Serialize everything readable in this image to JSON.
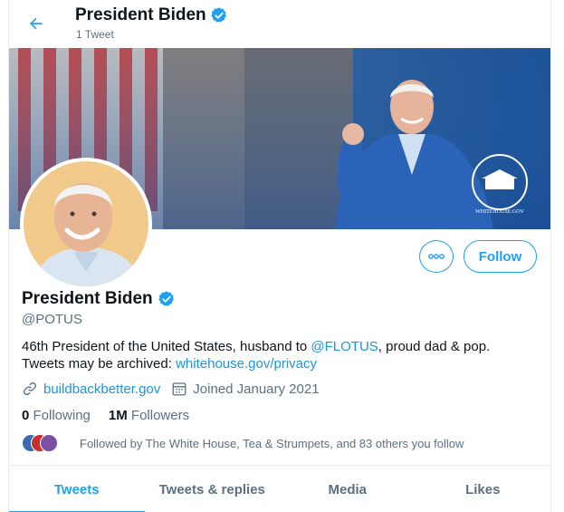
{
  "header": {
    "name": "President Biden",
    "tweet_count": "1 Tweet"
  },
  "banner": {
    "watermark": "WHITEHOUSE.GOV"
  },
  "actions": {
    "more_label": "ooo",
    "follow_label": "Follow"
  },
  "profile": {
    "display_name": "President Biden",
    "handle": "@POTUS",
    "bio": {
      "part1": "46th President of the United States, husband to ",
      "mention": "@FLOTUS",
      "part2": ", proud dad & pop.",
      "part3": "Tweets may be archived: ",
      "archive_link": "whitehouse.gov/privacy"
    },
    "website": "buildbackbetter.gov",
    "joined": "Joined January 2021",
    "following_count": "0",
    "following_label": "Following",
    "followers_count": "1M",
    "followers_label": "Followers",
    "followed_by": "Followed by The White House, Tea & Strumpets, and 83 others you follow"
  },
  "tabs": [
    {
      "label": "Tweets",
      "active": true
    },
    {
      "label": "Tweets & replies",
      "active": false
    },
    {
      "label": "Media",
      "active": false
    },
    {
      "label": "Likes",
      "active": false
    }
  ],
  "colors": {
    "accent": "#1da1f2",
    "link": "#1b95e0",
    "secondary_text": "#5b7083",
    "banner_blue": "#1e5a9e"
  },
  "icons": {
    "back": "arrow-left-icon",
    "verified": "verified-badge-icon",
    "website": "link-icon",
    "joined": "calendar-icon"
  }
}
